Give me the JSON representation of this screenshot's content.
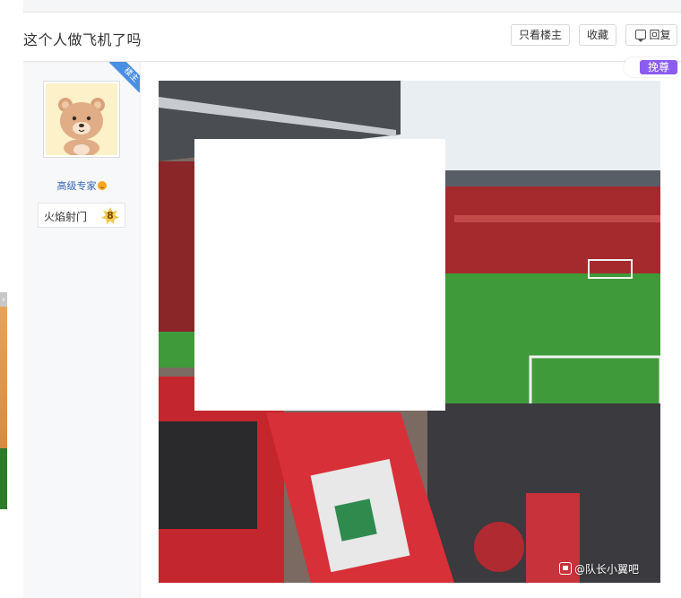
{
  "thread": {
    "title": "这个人做飞机了吗"
  },
  "actions": {
    "only_op_label": "只看楼主",
    "favorite_label": "收藏",
    "reply_label": "回复"
  },
  "post": {
    "op_badge": "楼主",
    "author": {
      "level_title": "高级专家",
      "badge_name": "火焰射门",
      "badge_level": "8"
    },
    "reward_label": "挽尊",
    "image_watermark": "@队长小翼吧"
  },
  "colors": {
    "link_blue": "#3164b4",
    "op_badge_blue": "#4a90e2",
    "reward_purple": "#8a5cf0",
    "pitch_green": "#3f9a3a",
    "stand_red": "#b0262b"
  }
}
